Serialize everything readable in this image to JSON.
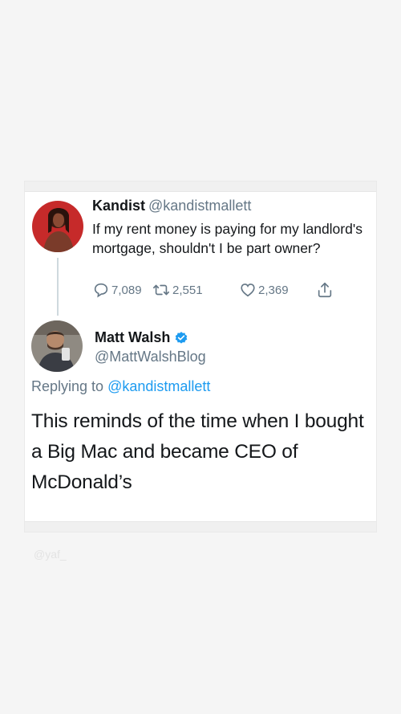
{
  "tweet1": {
    "name": "Kandist",
    "handle": "@kandistmallett",
    "text": "If my rent money is paying for my landlord's mortgage, shouldn't I be part owner?",
    "replies": "7,089",
    "retweets": "2,551",
    "likes": "2,369",
    "avatar_icon": "user-avatar-kandist"
  },
  "tweet2": {
    "name": "Matt Walsh",
    "handle": "@MattWalshBlog",
    "verified_icon": "verified-badge-icon",
    "replying_prefix": "Replying to",
    "replying_to": "@kandistmallett",
    "text": "This reminds of the time when I bought a Big Mac and became CEO of McDonald’s",
    "avatar_icon": "user-avatar-mattwalsh"
  },
  "watermark": "@yaf_",
  "colors": {
    "link": "#1d9bf0",
    "secondary_text": "#657786",
    "primary_text": "#14171a",
    "background": "#f5f5f5"
  }
}
